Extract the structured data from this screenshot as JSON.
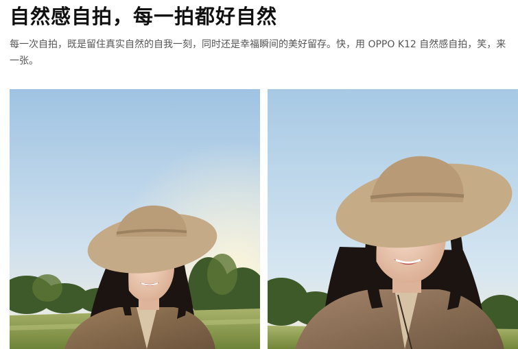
{
  "article": {
    "title": "自然感自拍，每一拍都好自然",
    "subtitle": "每一次自拍，既是留住真实自然的自我一刻，同时还是幸福瞬间的美好留存。快，用 OPPO K12 自然感自拍，笑，来一张。"
  },
  "colors": {
    "title": "#111111",
    "subtitle": "#555555",
    "sky": "#bcd6ea",
    "grass": "#8fa24e",
    "hat": "#c4aa86",
    "jacket": "#8a6e4f",
    "hair": "#1c1410"
  },
  "photos": [
    {
      "name": "selfie-photo-left"
    },
    {
      "name": "selfie-photo-right"
    }
  ]
}
